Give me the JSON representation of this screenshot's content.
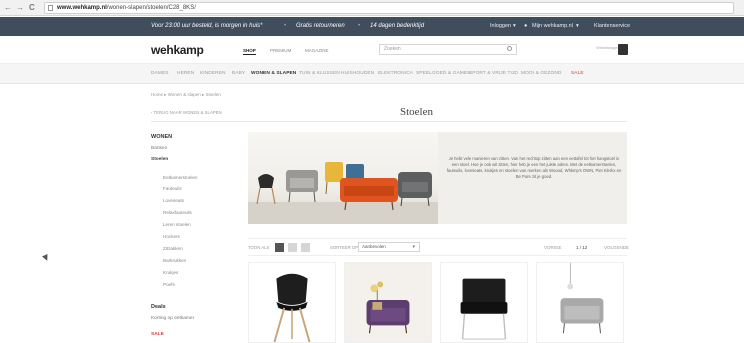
{
  "browser": {
    "back_glyph": "←",
    "forward_glyph": "→",
    "reload_glyph": "C",
    "url_host": "www.wehkamp.nl",
    "url_path": "/wonen-slapen/stoelen/C28_8KS/"
  },
  "promo": {
    "items": [
      "Voor 23:00 uur besteld, is morgen in huis*",
      "Gratis retourneren",
      "14 dagen bedenktijd"
    ],
    "login": "Inloggen",
    "my_account": "Mijn wehkamp.nl",
    "service": "Klantenservice"
  },
  "header": {
    "logo": "wehkamp",
    "tabs": [
      "SHOP",
      "PREMIUM",
      "MAGAZINE"
    ],
    "search_placeholder": "Zoeken",
    "cart_label": "Winkelwagen"
  },
  "categories": [
    "DAMES",
    "HEREN",
    "KINDEREN",
    "BABY",
    "WONEN & SLAPEN",
    "TUIN & KLUSSEN",
    "HUISHOUDEN",
    "ELEKTRONICA",
    "SPEELGOED & GAMES",
    "SPORT & VRIJE TIJD",
    "MOOI & GEZOND",
    "SALE"
  ],
  "breadcrumb": "Home  ▸  Wonen & slapen  ▸  Stoelen",
  "back_link": "‹ TERUG NAAR WONEN & SLAPEN",
  "page_title": "Stoelen",
  "sidebar": {
    "heading": "WONEN",
    "top_links": [
      "Banken",
      "Stoelen"
    ],
    "sub_links": [
      "Eetkamerstoelen",
      "Fauteuils",
      "Loveseats",
      "Relaxfauteuils",
      "Leren stoelen",
      "Hockers",
      "Zitzakken",
      "Barkrukken",
      "Krukjes",
      "Poefs"
    ],
    "deals_heading": "Deals",
    "deals_link": "Korting op eetkamer",
    "sale_link": "SALE"
  },
  "hero": {
    "text": "Je hebt vele manieren van zitten. Van het rechtop zitten aan een eettafel tot het hangstoel in een stoel. Hoe je ook wil zitten, hier heb je een het juiste adres. Met de eetkamerstoelen, fauteuils, loveseats, krukjes en stoelen van merken als Woood, Whkmp's OWN, Piet Klerkx en Be Pure zit je goed."
  },
  "toolbar": {
    "view_label": "TOON ALS",
    "sort_label": "SORTEER OP",
    "sort_value": "Aanbevolen",
    "prev_label": "VORIGE",
    "page": "1 / 12",
    "next_label": "VOLGENDE"
  }
}
